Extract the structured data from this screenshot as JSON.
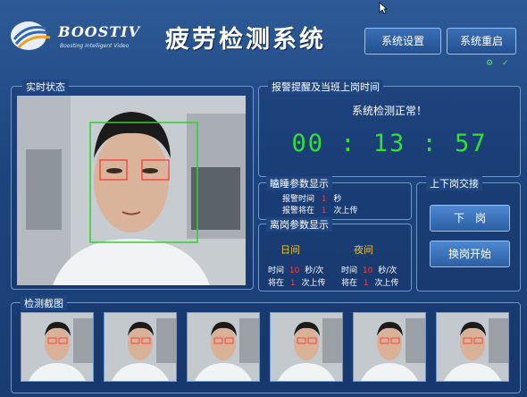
{
  "header": {
    "brand": "BOOSTIV",
    "tagline": "Boosting Intelligent Video",
    "title": "疲劳检测系统",
    "settings_button": "系统设置",
    "restart_button": "系统重启",
    "status_mark_1": "⚙",
    "status_mark_2": "✓"
  },
  "live": {
    "title": "实时状态"
  },
  "alarm": {
    "title": "报警提醒及当班上岗时间",
    "status": "系统检测正常！",
    "timer": "00 : 13 : 57"
  },
  "sleep": {
    "title": "瞌睡参数显示",
    "row1_label": "报警时间",
    "row1_value": "1",
    "row1_unit": "秒",
    "row2_label": "报警将在",
    "row2_value": "1",
    "row2_unit": "次上传"
  },
  "leave": {
    "title": "离岗参数显示",
    "day_label": "日间",
    "night_label": "夜间",
    "time_label": "时间",
    "day_time_value": "10",
    "unit_per": "秒/次",
    "night_time_value": "10",
    "night_unit_per": "秒/次",
    "upload_label": "将在",
    "day_upload_value": "1",
    "upload_unit": "次上传",
    "night_upload_value": "1"
  },
  "shift": {
    "title": "上下岗交接",
    "off_button": "下　岗",
    "start_button": "换岗开始"
  },
  "capture": {
    "title": "检测截图",
    "count": 6
  },
  "colors": {
    "accent": "#34e030",
    "alert": "#ff3a3a",
    "label": "#f0c030"
  }
}
